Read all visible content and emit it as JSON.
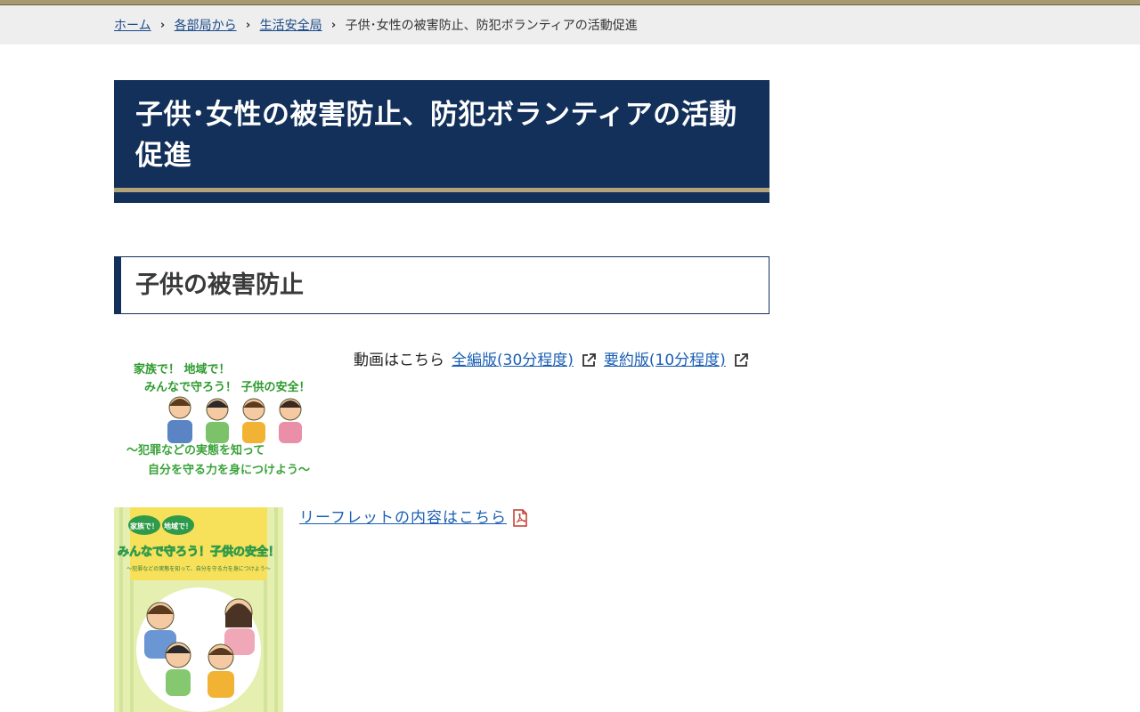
{
  "breadcrumb": {
    "items": [
      "ホーム",
      "各部局から",
      "生活安全局"
    ],
    "current": "子供･女性の被害防止、防犯ボランティアの活動促進",
    "separator": "›"
  },
  "page": {
    "title": "子供･女性の被害防止、防犯ボランティアの活動促進"
  },
  "section": {
    "heading": "子供の被害防止"
  },
  "video": {
    "intro": "動画はこちら",
    "links": [
      "全編版(30分程度)",
      "要約版(10分程度)"
    ],
    "banner": {
      "line1": "家族で！ 地域で！",
      "line2": "みんなで守ろう！ 子供の安全！",
      "line3": "～犯罪などの実態を知って",
      "line4": "自分を守る力を身につけよう～"
    }
  },
  "leaflet": {
    "link": "リーフレットの内容はこちら",
    "cover": {
      "bubble1": "家族で！",
      "bubble2": "地域で！",
      "title": "みんなで守ろう！子供の安全！",
      "subtitle": "～犯罪などの実態を知って、自分を守る力を身につけよう～"
    }
  },
  "colors": {
    "navy": "#12305a",
    "gold": "#b3a37a",
    "link": "#1a5fb4",
    "green_text": "#2e9b2e",
    "pdf_red": "#c0392b"
  }
}
